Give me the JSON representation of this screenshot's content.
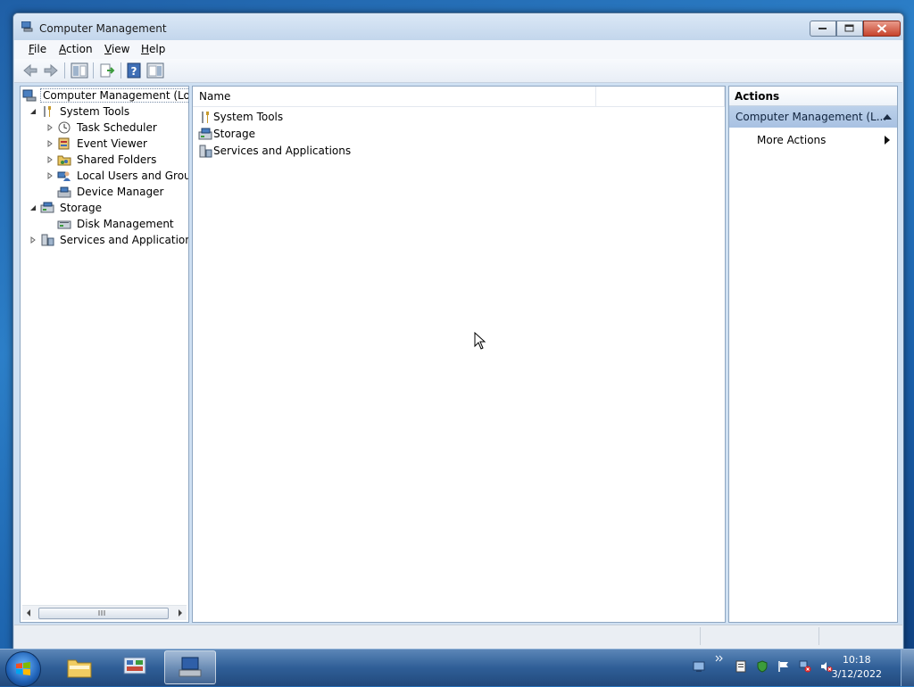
{
  "window": {
    "title": "Computer Management",
    "menu": [
      "File",
      "Action",
      "View",
      "Help"
    ]
  },
  "tree": {
    "root": "Computer Management (Local",
    "items": [
      {
        "label": "System Tools",
        "icon": "tools-icon",
        "expanded": true
      },
      {
        "label": "Task Scheduler",
        "icon": "clock-icon"
      },
      {
        "label": "Event Viewer",
        "icon": "event-viewer-icon"
      },
      {
        "label": "Shared Folders",
        "icon": "shared-folder-icon"
      },
      {
        "label": "Local Users and Groups",
        "icon": "users-icon"
      },
      {
        "label": "Device Manager",
        "icon": "device-manager-icon"
      },
      {
        "label": "Storage",
        "icon": "storage-icon",
        "expanded": true
      },
      {
        "label": "Disk Management",
        "icon": "disk-icon"
      },
      {
        "label": "Services and Applications",
        "icon": "services-icon"
      }
    ]
  },
  "list": {
    "column_name": "Name",
    "rows": [
      {
        "label": "System Tools",
        "icon": "tools-icon"
      },
      {
        "label": "Storage",
        "icon": "storage-icon"
      },
      {
        "label": "Services and Applications",
        "icon": "services-icon"
      }
    ]
  },
  "actions": {
    "header": "Actions",
    "section": "Computer Management (L...",
    "more": "More Actions"
  },
  "taskbar": {
    "time": "10:18",
    "date": "3/12/2022"
  },
  "colors": {
    "selection": "#bcd1ea",
    "taskbar": "#2f5e97"
  }
}
